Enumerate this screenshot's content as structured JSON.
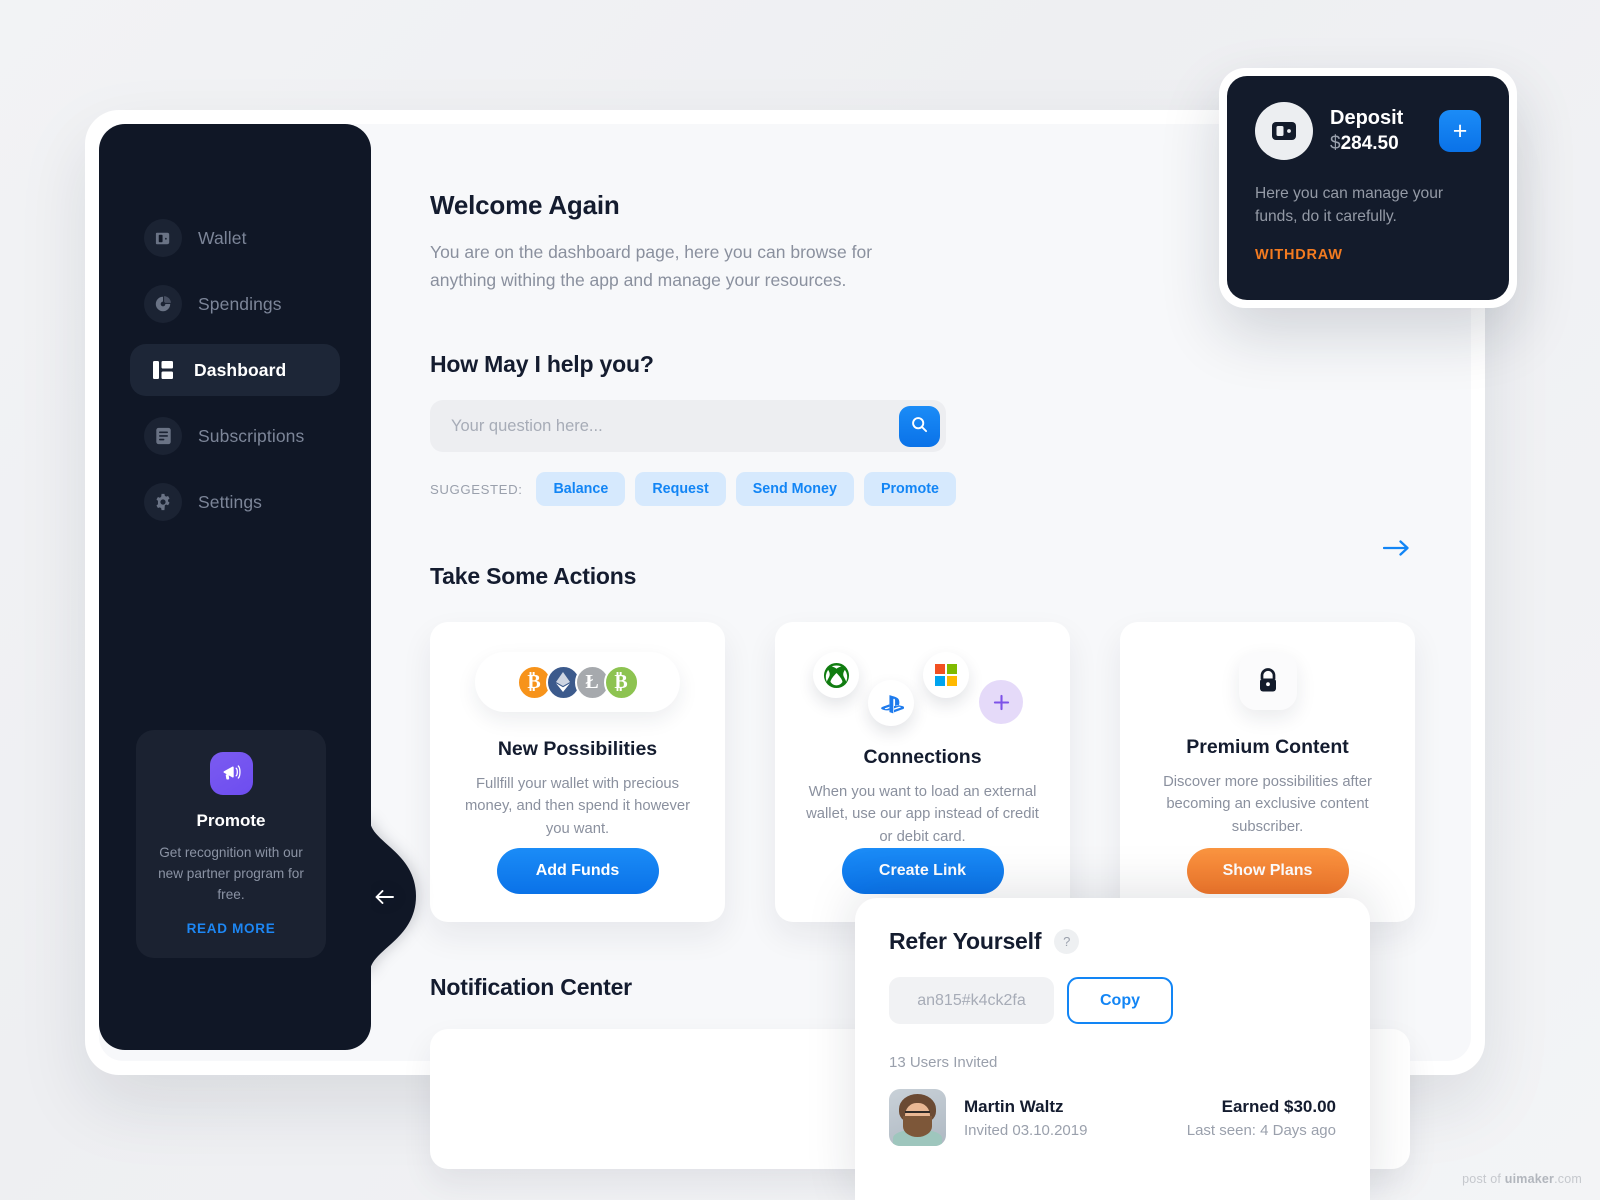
{
  "sidebar": {
    "items": [
      {
        "label": "Wallet",
        "icon": "wallet-icon",
        "active": false
      },
      {
        "label": "Spendings",
        "icon": "pie-chart-icon",
        "active": false
      },
      {
        "label": "Dashboard",
        "icon": "dashboard-icon",
        "active": true
      },
      {
        "label": "Subscriptions",
        "icon": "list-icon",
        "active": false
      },
      {
        "label": "Settings",
        "icon": "gear-icon",
        "active": false
      }
    ],
    "promote": {
      "icon": "megaphone-icon",
      "title": "Promote",
      "text": "Get recognition with our new partner program for free.",
      "link": "READ MORE"
    },
    "collapse_icon": "arrow-left-icon"
  },
  "main": {
    "welcome_title": "Welcome Again",
    "welcome_text": "You are on the dashboard page, here you can browse for anything withing the app and manage your resources.",
    "help_title": "How May I help you?",
    "search": {
      "placeholder": "Your question here...",
      "value": "",
      "button_icon": "search-icon"
    },
    "suggested_label": "SUGGESTED:",
    "suggested": [
      "Balance",
      "Request",
      "Send Money",
      "Promote"
    ],
    "actions_title": "Take Some Actions",
    "actions_next_icon": "arrow-right-icon",
    "cards": [
      {
        "title": "New Possibilities",
        "text": "Fullfill your wallet with precious money, and then spend it however you want.",
        "button": "Add Funds",
        "button_color": "#0a72e8",
        "icons": [
          "bitcoin-icon",
          "ethereum-icon",
          "litecoin-icon",
          "bitcoin-cash-icon"
        ]
      },
      {
        "title": "Connections",
        "text": "When you want to load an external wallet, use our app instead of credit or debit card.",
        "button": "Create Link",
        "button_color": "#0a72e8",
        "icons": [
          "xbox-icon",
          "playstation-icon",
          "microsoft-icon",
          "add-connection-icon"
        ]
      },
      {
        "title": "Premium Content",
        "text": "Discover more possibilities after becoming an exclusive content subscriber.",
        "button": "Show Plans",
        "button_color": "#f2762a",
        "icons": [
          "lock-icon"
        ]
      }
    ],
    "notification_title": "Notification Center"
  },
  "deposit": {
    "icon": "wallet-icon",
    "title": "Deposit",
    "currency": "$",
    "amount": "284.50",
    "add_label": "+",
    "text": "Here you can manage your funds, do it carefully.",
    "link": "WITHDRAW",
    "accent": "#f47b20"
  },
  "refer": {
    "title": "Refer Yourself",
    "help_icon": "question-icon",
    "code": "an815#k4ck2fa",
    "copy_label": "Copy",
    "invited_count": "13 Users Invited",
    "user": {
      "name": "Martin Waltz",
      "invited": "Invited 03.10.2019",
      "earned": "Earned $30.00",
      "last_seen": "Last seen: 4 Days ago"
    }
  },
  "watermark": {
    "prefix": "post of ",
    "brand": "uimaker",
    "suffix": ".com"
  }
}
